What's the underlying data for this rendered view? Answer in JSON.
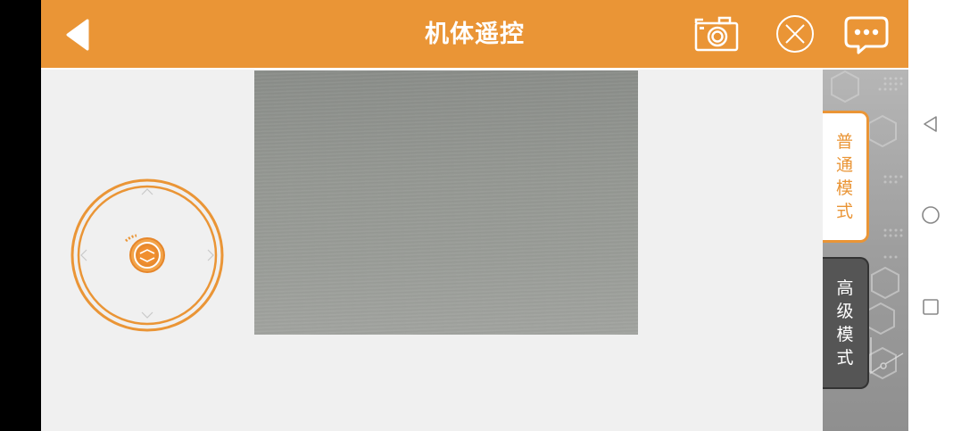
{
  "header": {
    "title": "机体遥控"
  },
  "modes": {
    "normal": [
      "普",
      "通",
      "模",
      "式"
    ],
    "advanced": [
      "高",
      "级",
      "模",
      "式"
    ]
  },
  "colors": {
    "accent": "#ea9536",
    "header_text": "#ffffff",
    "advanced_tab_bg": "#555555"
  },
  "icons": {
    "back": "back-arrow-icon",
    "camera": "camera-icon",
    "close": "close-circle-icon",
    "chat": "chat-bubble-icon",
    "joystick_center": "joystick-knob-icon",
    "nav_back": "triangle-back-icon",
    "nav_home": "circle-home-icon",
    "nav_recent": "square-recent-icon"
  }
}
